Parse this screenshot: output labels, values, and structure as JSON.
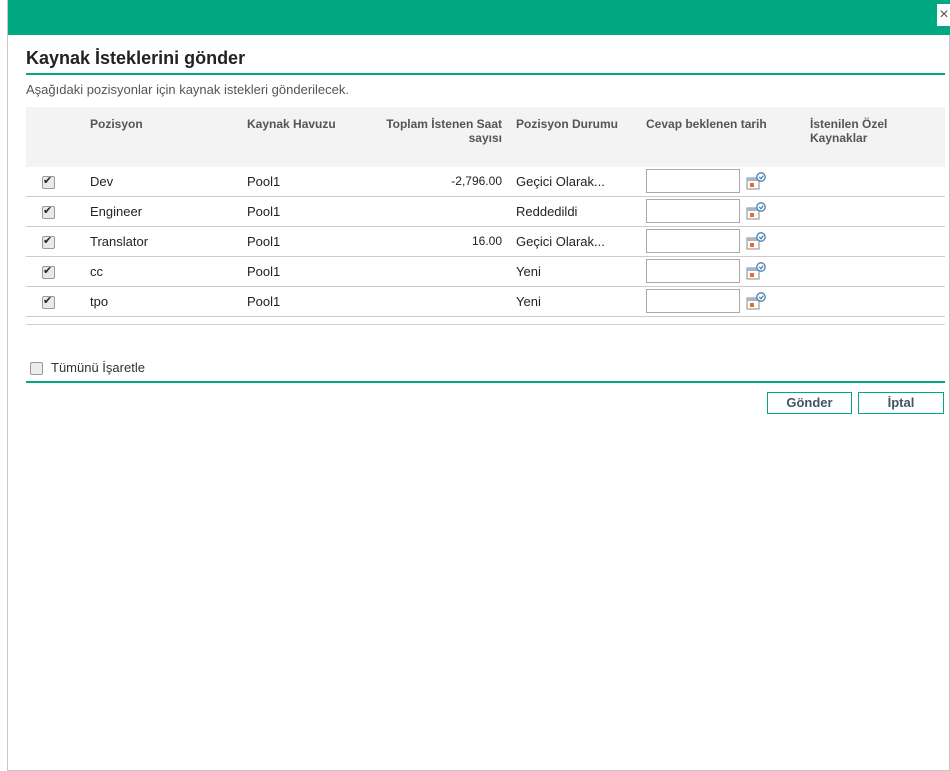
{
  "dialog": {
    "close_glyph": "×",
    "title": "Kaynak İsteklerini gönder",
    "subtitle": "Aşağıdaki pozisyonlar için kaynak istekleri gönderilecek."
  },
  "table": {
    "headers": {
      "position": "Pozisyon",
      "pool": "Kaynak Havuzu",
      "hours": "Toplam İstenen Saat sayısı",
      "status": "Pozisyon Durumu",
      "response_date": "Cevap beklenen tarih",
      "named_resources": "İstenilen Özel Kaynaklar"
    },
    "rows": [
      {
        "checked": true,
        "position": "Dev",
        "pool": "Pool1",
        "hours": "-2,796.00",
        "status": "Geçici Olarak...",
        "date": ""
      },
      {
        "checked": true,
        "position": "Engineer",
        "pool": "Pool1",
        "hours": "",
        "status": "Reddedildi",
        "date": ""
      },
      {
        "checked": true,
        "position": "Translator",
        "pool": "Pool1",
        "hours": "16.00",
        "status": "Geçici Olarak...",
        "date": ""
      },
      {
        "checked": true,
        "position": "cc",
        "pool": "Pool1",
        "hours": "",
        "status": "Yeni",
        "date": ""
      },
      {
        "checked": true,
        "position": "tpo",
        "pool": "Pool1",
        "hours": "",
        "status": "Yeni",
        "date": ""
      }
    ]
  },
  "check_all": {
    "label": "Tümünü İşaretle",
    "checked": false
  },
  "buttons": {
    "submit": "Gönder",
    "cancel": "İptal"
  },
  "icons": {
    "close": "close-icon",
    "calendar": "calendar-icon"
  },
  "colors": {
    "accent": "#01a982",
    "button_text": "#425563"
  }
}
